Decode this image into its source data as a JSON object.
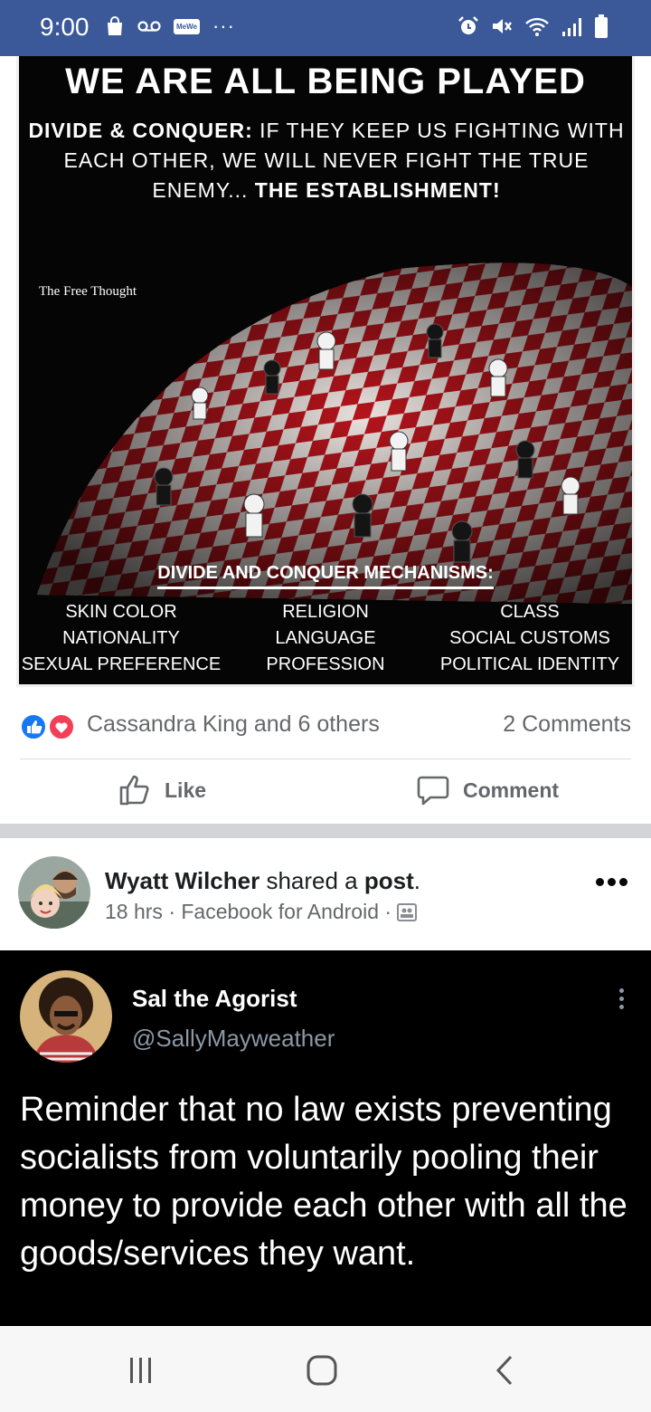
{
  "status_bar": {
    "time": "9:00",
    "app_badge": "MeWe",
    "overflow": "···",
    "icons": [
      "shopping-bag-icon",
      "voicemail-icon",
      "alarm-icon",
      "mute-icon",
      "wifi-icon",
      "signal-icon",
      "battery-icon"
    ]
  },
  "meme": {
    "title": "WE ARE ALL BEING PLAYED",
    "subtitle_lead": "DIVIDE & CONQUER:",
    "subtitle_body": " IF THEY KEEP US FIGHTING WITH EACH OTHER, WE WILL NEVER FIGHT THE TRUE ENEMY... ",
    "subtitle_end": "THE ESTABLISHMENT!",
    "watermark": "The Free Thought",
    "mechanisms_title": "DIVIDE AND CONQUER MECHANISMS:",
    "mechanisms": [
      [
        "SKIN COLOR",
        "RELIGION",
        "CLASS"
      ],
      [
        "NATIONALITY",
        "LANGUAGE",
        "SOCIAL CUSTOMS"
      ],
      [
        "SEXUAL PREFERENCE",
        "PROFESSION",
        "POLITICAL IDENTITY"
      ]
    ]
  },
  "reactions": {
    "summary": "Cassandra King and 6 others",
    "comments": "2 Comments",
    "colors": {
      "like": "#1877f2",
      "love": "#f33e58"
    }
  },
  "actions": {
    "like": "Like",
    "comment": "Comment"
  },
  "post2": {
    "author": "Wyatt Wilcher",
    "shared_text": " shared a ",
    "post_word": "post",
    "period": ".",
    "meta": "18 hrs · Facebook for Android ·",
    "privacy_icon": "friends-icon"
  },
  "tweet": {
    "name": "Sal the Agorist",
    "handle": "@SallyMayweather",
    "body": "Reminder that no law exists preventing socialists from voluntarily pooling their money to provide each other with all the goods/services they want."
  },
  "navbar": {
    "icons": [
      "recent-apps-icon",
      "home-icon",
      "back-icon"
    ]
  },
  "theme": {
    "header_blue": "#3b5998",
    "text_gray": "#65676b"
  }
}
